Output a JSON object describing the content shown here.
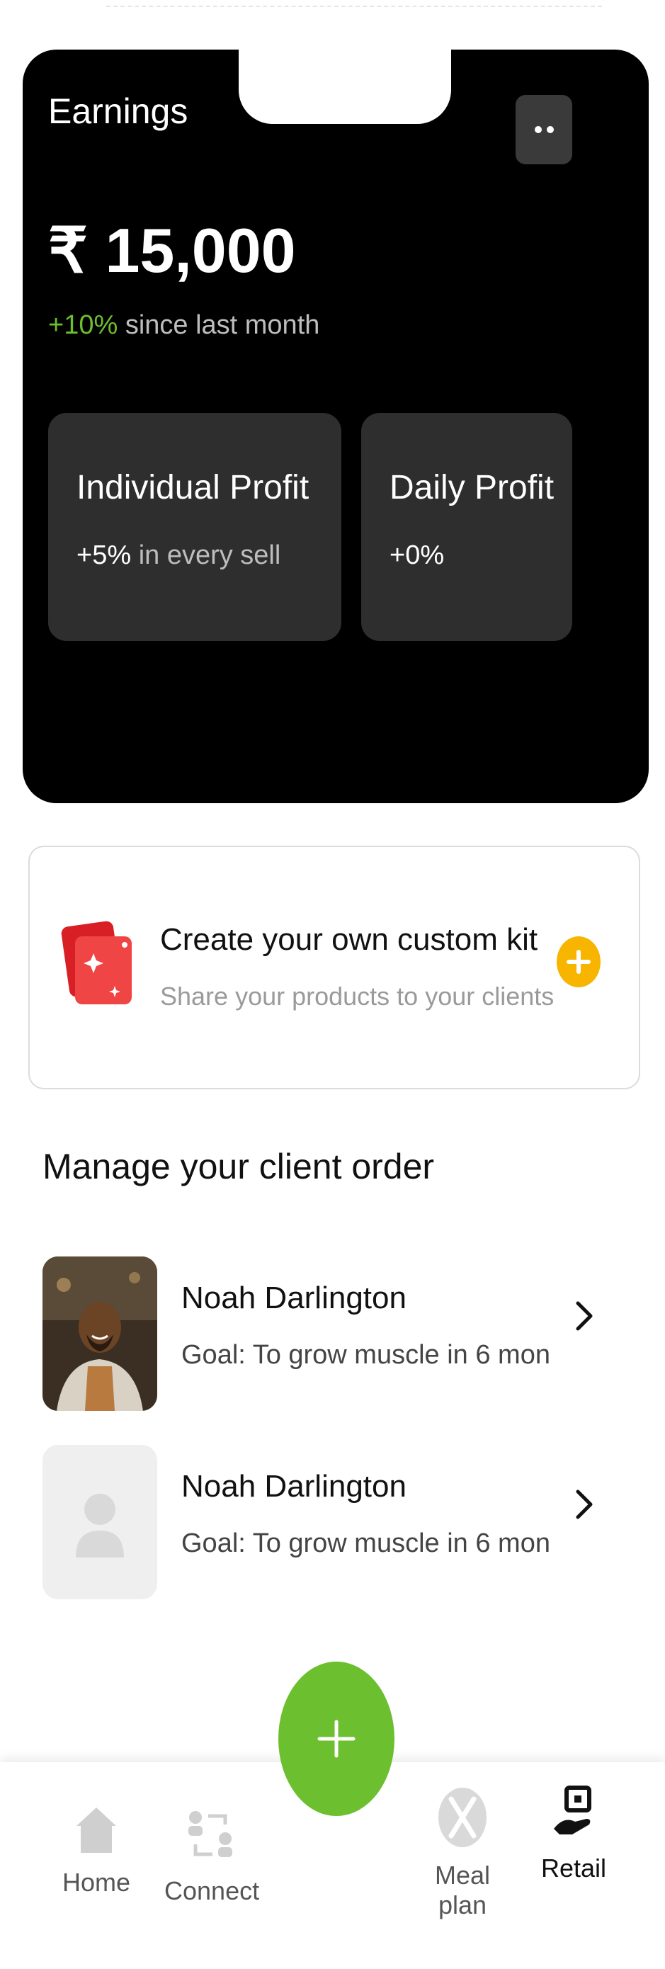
{
  "earnings": {
    "title": "Earnings",
    "amount": "₹ 15,000",
    "change_pct": "+10%",
    "change_text": "since last month",
    "cards": [
      {
        "title": "Individual Profit",
        "value": "+5%",
        "suffix": "in every sell"
      },
      {
        "title": "Daily Profit",
        "value": "+0%",
        "suffix": ""
      }
    ]
  },
  "custom_kit": {
    "title": "Create your own custom kit",
    "subtitle": "Share your products to your clients"
  },
  "clients": {
    "section_title": "Manage your client order",
    "items": [
      {
        "name": "Noah Darlington",
        "goal": "Goal: To grow muscle in 6 mon"
      },
      {
        "name": "Noah Darlington",
        "goal": "Goal: To grow muscle in 6 mon"
      }
    ]
  },
  "nav": {
    "items": [
      {
        "label": "Home",
        "icon": "home-icon"
      },
      {
        "label": "Connect",
        "icon": "connect-icon"
      },
      {
        "label": "Meal plan",
        "icon": "meal-plan-icon"
      },
      {
        "label": "Retail",
        "icon": "retail-icon",
        "active": true
      }
    ]
  },
  "colors": {
    "accent_green": "#6cbf2e",
    "accent_yellow": "#f7b500",
    "kit_red": "#ef3b3b",
    "card_bg": "#000000"
  }
}
